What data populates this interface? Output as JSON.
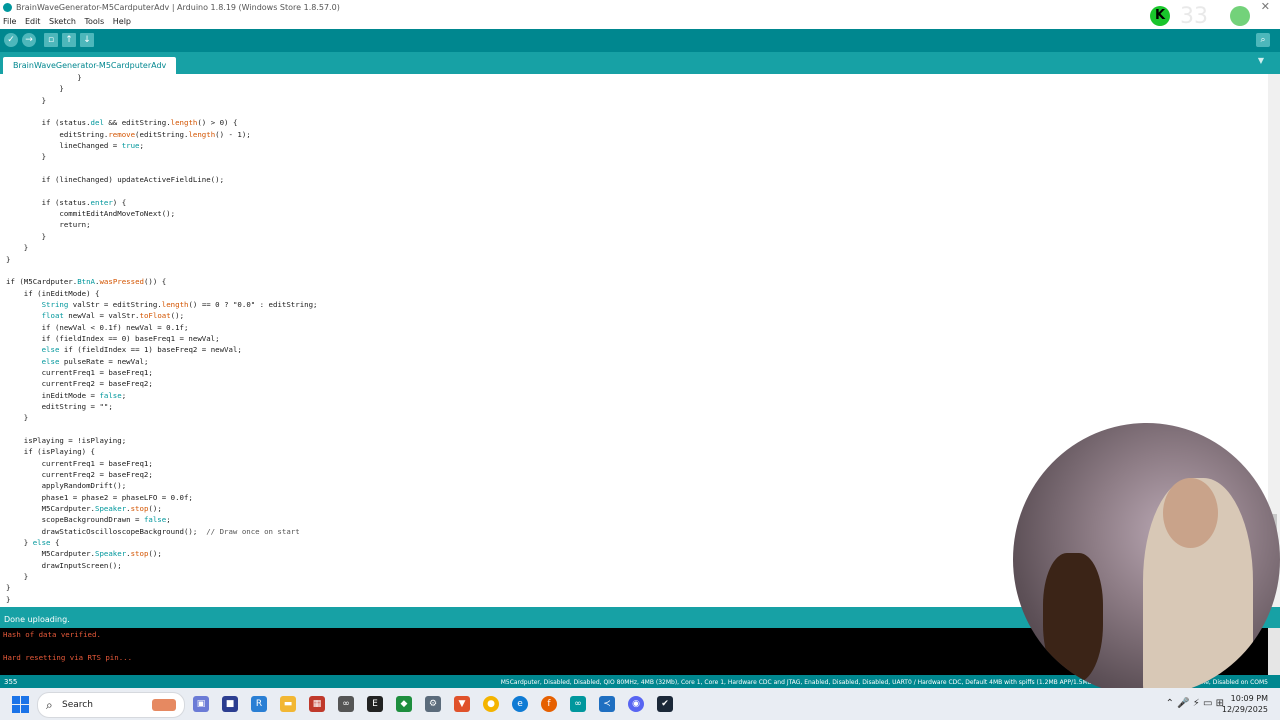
{
  "window": {
    "title": "BrainWaveGenerator-M5CardputerAdv | Arduino 1.8.19 (Windows Store 1.8.57.0)"
  },
  "menu": [
    "File",
    "Edit",
    "Sketch",
    "Tools",
    "Help"
  ],
  "toolbar": {
    "buttons": [
      "verify",
      "upload",
      "new",
      "open",
      "save"
    ],
    "serial_monitor": "serial-monitor"
  },
  "tab": {
    "label": "BrainWaveGenerator-M5CardputerAdv"
  },
  "code_lines": [
    "                }",
    "            }",
    "        }",
    "",
    "        if (status.del && editString.length() > 0) {",
    "            editString.remove(editString.length() - 1);",
    "            lineChanged = true;",
    "        }",
    "",
    "        if (lineChanged) updateActiveFieldLine();",
    "",
    "        if (status.enter) {",
    "            commitEditAndMoveToNext();",
    "            return;",
    "        }",
    "    }",
    "}",
    "",
    "if (M5Cardputer.BtnA.wasPressed()) {",
    "    if (inEditMode) {",
    "        String valStr = editString.length() == 0 ? \"0.0\" : editString;",
    "        float newVal = valStr.toFloat();",
    "        if (newVal < 0.1f) newVal = 0.1f;",
    "        if (fieldIndex == 0) baseFreq1 = newVal;",
    "        else if (fieldIndex == 1) baseFreq2 = newVal;",
    "        else pulseRate = newVal;",
    "        currentFreq1 = baseFreq1;",
    "        currentFreq2 = baseFreq2;",
    "        inEditMode = false;",
    "        editString = \"\";",
    "    }",
    "",
    "    isPlaying = !isPlaying;",
    "    if (isPlaying) {",
    "        currentFreq1 = baseFreq1;",
    "        currentFreq2 = baseFreq2;",
    "        applyRandomDrift();",
    "        phase1 = phase2 = phaseLFO = 0.0f;",
    "        M5Cardputer.Speaker.stop();",
    "        scopeBackgroundDrawn = false;",
    "        drawStaticOscilloscopeBackground();  // Draw once on start",
    "    } else {",
    "        M5Cardputer.Speaker.stop();",
    "        drawInputScreen();",
    "    }",
    "}",
    "}"
  ],
  "status": {
    "message": "Done uploading."
  },
  "console": {
    "line1": "Hash of data verified.",
    "line2": "Hard resetting via RTS pin..."
  },
  "footer": {
    "line_number": "355",
    "board_info": "M5Cardputer, Disabled, Disabled, QIO 80MHz, 4MB (32Mb), Core 1, Core 1, Hardware CDC and JTAG, Enabled, Disabled, Disabled, UART0 / Hardware CDC, Default 4MB with spiffs (1.2MB APP/1.5MB SPIFFS), 240MHz (WiFi), 921600, None, Disabled on COM5"
  },
  "overlay": {
    "k_label": "K",
    "number": "33"
  },
  "taskbar": {
    "search_label": "Search",
    "time": "10:09 PM",
    "date": "12/29/2025",
    "icons": [
      "start-icon",
      "search-icon",
      "task-view-icon",
      "app-icon",
      "remote-icon",
      "file-explorer-icon",
      "store-icon",
      "arduino-icon",
      "epic-icon",
      "vpn-icon",
      "settings-icon",
      "brave-icon",
      "chrome-icon",
      "edge-icon",
      "firefox-icon",
      "app-icon",
      "vscode-icon",
      "discord-icon",
      "steam-icon"
    ],
    "colors": {
      "taskbar_bg": "#e9edf3",
      "accent": "#00878f"
    }
  }
}
